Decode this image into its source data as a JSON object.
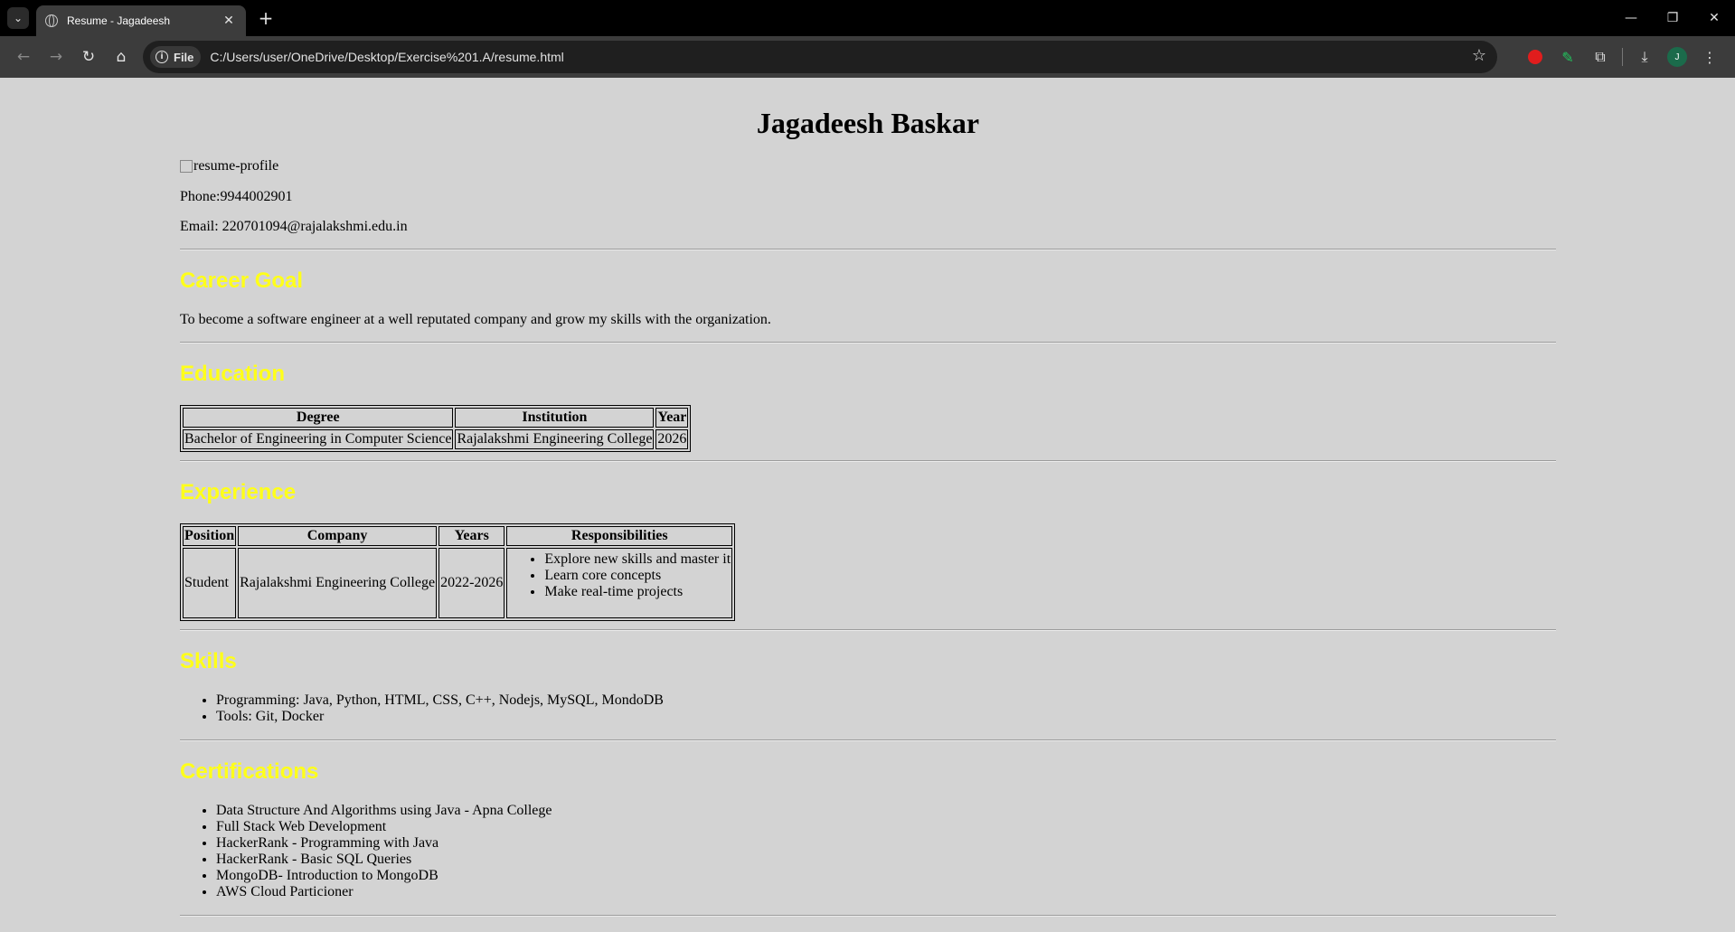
{
  "browser": {
    "tab_title": "Resume - Jagadeesh",
    "new_tab_symbol": "+",
    "address_chip": "File",
    "url": "C:/Users/user/OneDrive/Desktop/Exercise%201.A/resume.html",
    "profile_initial": "J"
  },
  "resume": {
    "name": "Jagadeesh Baskar",
    "profile_image_alt": "resume-profile",
    "phone": "Phone:9944002901",
    "email": "Email: 220701094@rajalakshmi.edu.in",
    "career": {
      "heading": "Career Goal",
      "text": "To become a software engineer at a well reputated company and grow my skills with the organization."
    },
    "education": {
      "heading": "Education",
      "columns": [
        "Degree",
        "Institution",
        "Year"
      ],
      "rows": [
        [
          "Bachelor of Engineering in Computer Science",
          "Rajalakshmi Engineering College",
          "2026"
        ]
      ]
    },
    "experience": {
      "heading": "Experience",
      "columns": [
        "Position",
        "Company",
        "Years",
        "Responsibilities"
      ],
      "position": "Student",
      "company": "Rajalakshmi Engineering College",
      "years": "2022-2026",
      "responsibilities": [
        "Explore new skills and master it",
        "Learn core concepts",
        "Make real-time projects"
      ]
    },
    "skills": {
      "heading": "Skills",
      "items": [
        "Programming: Java, Python, HTML, CSS, C++, Nodejs, MySQL, MondoDB",
        "Tools: Git, Docker"
      ]
    },
    "certifications": {
      "heading": "Certifications",
      "items": [
        "Data Structure And Algorithms using Java - Apna College",
        "Full Stack Web Development",
        "HackerRank - Programming with Java",
        "HackerRank - Basic SQL Queries",
        "MongoDB- Introduction to MongoDB",
        "AWS Cloud Particioner"
      ]
    }
  },
  "colors": {
    "page_background": "#d3d3d3",
    "heading_yellow": "#ffff1a",
    "chrome_dark": "#000000",
    "toolbar": "#3c3c3c"
  }
}
